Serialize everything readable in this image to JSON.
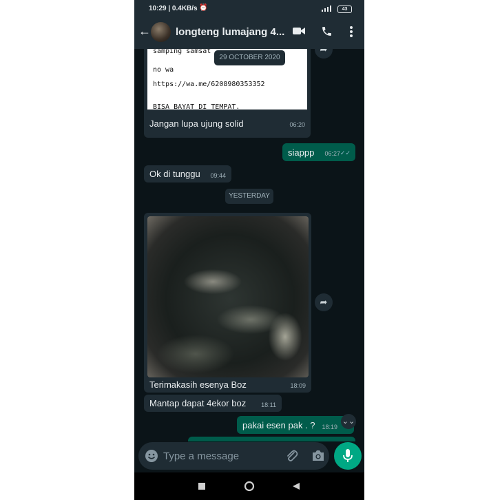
{
  "status_bar": {
    "time": "10:29 | 0.4KB/s",
    "battery": "43"
  },
  "header": {
    "contact_name": "longteng lumajang 4..."
  },
  "note_image": {
    "lines": [
      "samping samsat",
      "no wa",
      "https://wa.me/6208980353352",
      "BISA BAYAT DI TEMPAT."
    ]
  },
  "date_overlay": "29 OCTOBER 2020",
  "messages": [
    {
      "text": "Jangan lupa ujung solid",
      "time": "06:20",
      "direction": "in"
    },
    {
      "text": "siappp",
      "time": "06:27",
      "direction": "out",
      "ticks": "✓✓"
    },
    {
      "text": "Ok di tunggu",
      "time": "09:44",
      "direction": "in"
    },
    {
      "text": "Terimakasih esenya Boz",
      "time": "18:09",
      "direction": "in"
    },
    {
      "text": "Mantap dapat 4ekor boz",
      "time": "18:11",
      "direction": "in"
    },
    {
      "text": "pakai esen pak . ?",
      "time": "18:19",
      "direction": "out"
    }
  ],
  "date_divider": "YESTERDAY",
  "composer": {
    "placeholder": "Type a message"
  },
  "colors": {
    "incoming": "#1f2c34",
    "outgoing": "#005c4b",
    "accent": "#00a884",
    "background": "#0b1418"
  }
}
